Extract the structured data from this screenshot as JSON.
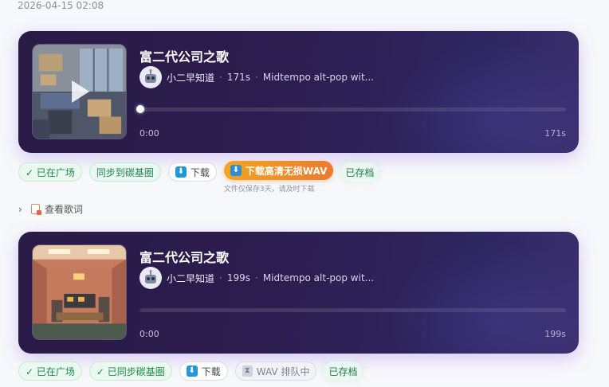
{
  "timestamp": "2026-04-15 02:08",
  "colors": {
    "accent_orange": "#ec7a2f",
    "card_bg": "#2b1d4f",
    "ok_green": "#1e8a4c"
  },
  "songs": [
    {
      "title": "富二代公司之歌",
      "author": "小二早知道",
      "duration": "171s",
      "style": "Midtempo alt-pop wit...",
      "time_start": "0:00",
      "time_end": "171s",
      "progress": 0.0,
      "actions": {
        "plaza": "✓ 已在广场",
        "sync": "同步到碳基圈",
        "download": "下载",
        "hq_wav": "下载高清无损WAV",
        "wav_note": "文件仅保存3天，请及时下载",
        "archived": "已存档"
      },
      "lyrics_label": "查看歌词"
    },
    {
      "title": "富二代公司之歌",
      "author": "小二早知道",
      "duration": "199s",
      "style": "Midtempo alt-pop wit...",
      "time_start": "0:00",
      "time_end": "199s",
      "progress": 0.0,
      "actions": {
        "plaza": "✓ 已在广场",
        "sync": "✓ 已同步碳基圈",
        "download": "下载",
        "wav_queue": "WAV 排队中",
        "archived": "已存档"
      }
    }
  ]
}
